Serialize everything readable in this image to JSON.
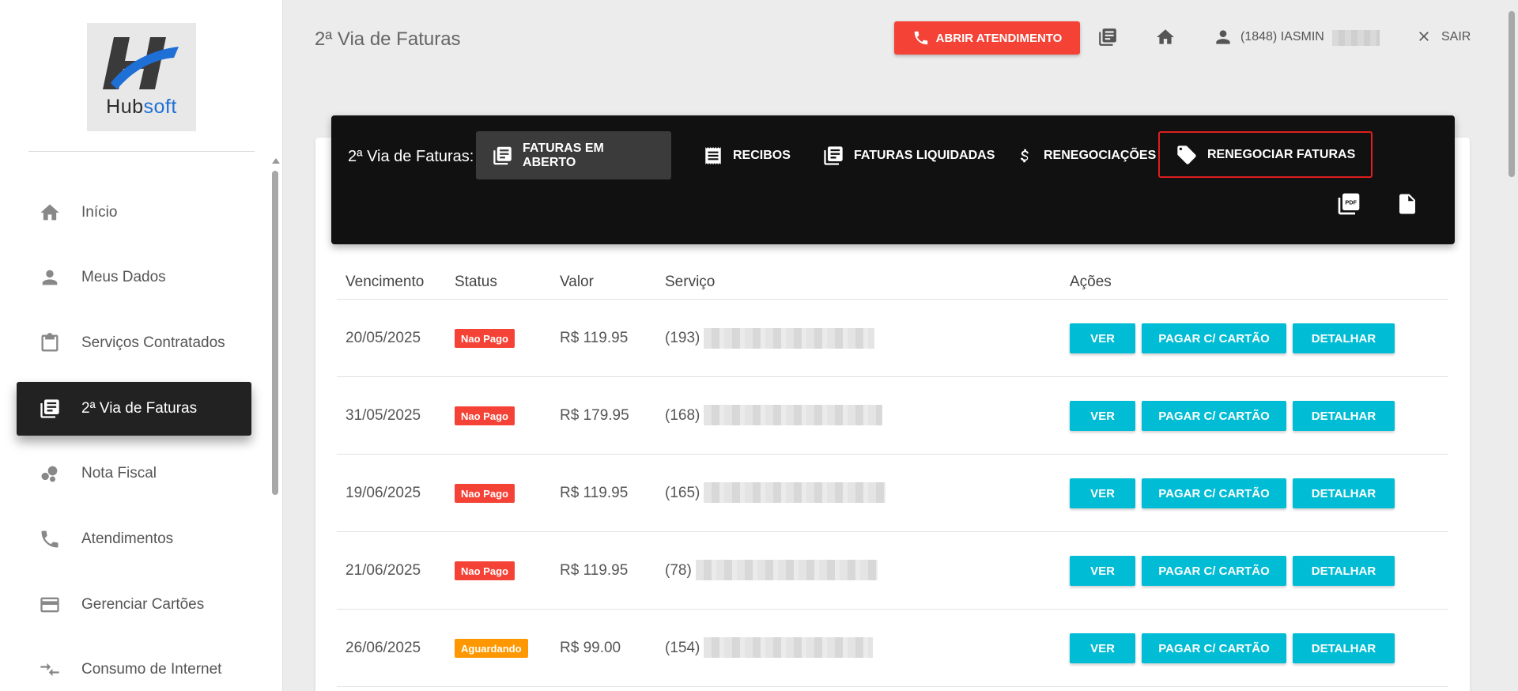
{
  "sidebar": {
    "logo": {
      "brand_dark": "Hub",
      "brand_accent": "soft"
    },
    "items": [
      {
        "label": "Início",
        "icon": "home-icon"
      },
      {
        "label": "Meus Dados",
        "icon": "person-icon"
      },
      {
        "label": "Serviços Contratados",
        "icon": "clipboard-icon"
      },
      {
        "label": "2ª Via de Faturas",
        "icon": "invoices-icon",
        "active": true
      },
      {
        "label": "Nota Fiscal",
        "icon": "bubbles-icon"
      },
      {
        "label": "Atendimentos",
        "icon": "phone-icon"
      },
      {
        "label": "Gerenciar Cartões",
        "icon": "credit-card-icon"
      },
      {
        "label": "Consumo de Internet",
        "icon": "transfer-arrows-icon"
      }
    ]
  },
  "header": {
    "title": "2ª Via de Faturas",
    "open_ticket_label": "ABRIR ATENDIMENTO",
    "user_label": "(1848) IASMIN",
    "logout_label": "SAIR"
  },
  "toolbar": {
    "label": "2ª Via de Faturas:",
    "tabs": [
      {
        "label": "FATURAS EM ABERTO",
        "icon": "invoices-icon"
      },
      {
        "label": "RECIBOS",
        "icon": "receipt-icon"
      },
      {
        "label": "FATURAS LIQUIDADAS",
        "icon": "invoices-icon"
      },
      {
        "label": "RENEGOCIAÇÕES",
        "icon": "dollar-icon"
      },
      {
        "label": "RENEGOCIAR FATURAS",
        "icon": "tag-icon"
      }
    ]
  },
  "table": {
    "headers": [
      "Vencimento",
      "Status",
      "Valor",
      "Serviço",
      "Ações"
    ],
    "actions": [
      "VER",
      "PAGAR C/ CARTÃO",
      "DETALHAR"
    ],
    "rows": [
      {
        "due": "20/05/2025",
        "status": "Nao Pago",
        "value": "R$ 119.95",
        "service": "(193)"
      },
      {
        "due": "31/05/2025",
        "status": "Nao Pago",
        "value": "R$ 179.95",
        "service": "(168)"
      },
      {
        "due": "19/06/2025",
        "status": "Nao Pago",
        "value": "R$ 119.95",
        "service": "(165)"
      },
      {
        "due": "21/06/2025",
        "status": "Nao Pago",
        "value": "R$ 119.95",
        "service": "(78)"
      },
      {
        "due": "26/06/2025",
        "status": "Aguardando",
        "value": "R$ 99.00",
        "service": "(154)"
      }
    ]
  },
  "colors": {
    "accent_red": "#f44336",
    "action_cyan": "#00bcd4",
    "pending_orange": "#ff9800",
    "toolbar_dark": "#111111"
  }
}
